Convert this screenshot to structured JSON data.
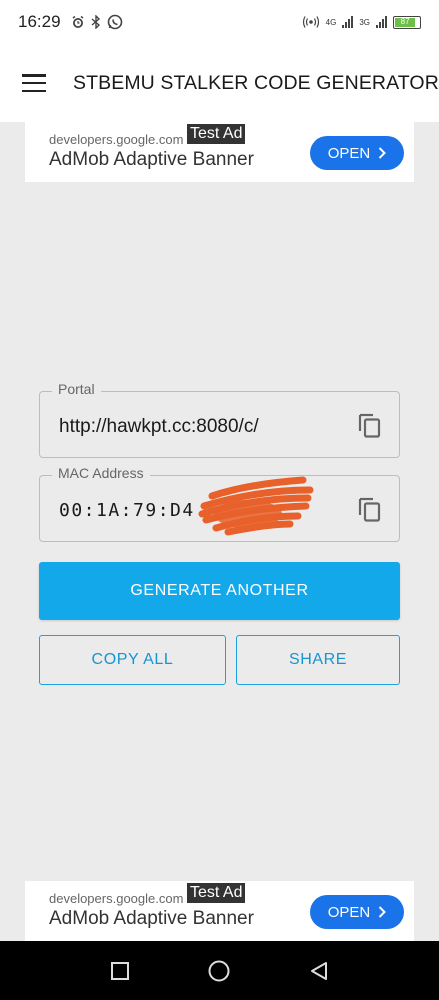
{
  "status_bar": {
    "time": "16:29",
    "network_4g": "4G",
    "network_3g": "3G",
    "battery": "87"
  },
  "app_bar": {
    "title": "STBEMU STALKER CODE GENERATOR"
  },
  "ads": {
    "top": {
      "domain": "developers.google.com",
      "tag": "Test Ad",
      "title": "AdMob Adaptive Banner",
      "button": "OPEN"
    },
    "bottom": {
      "domain": "developers.google.com",
      "tag": "Test Ad",
      "title": "AdMob Adaptive Banner",
      "button": "OPEN"
    }
  },
  "form": {
    "portal": {
      "label": "Portal",
      "value": "http://hawkpt.cc:8080/c/"
    },
    "mac": {
      "label": "MAC Address",
      "value": "00:1A:79:D4"
    }
  },
  "buttons": {
    "generate": "GENERATE ANOTHER",
    "copy_all": "COPY ALL",
    "share": "SHARE"
  },
  "icons": {
    "menu": "menu-icon",
    "copy": "copy-icon",
    "chevron": "chevron-right-icon",
    "nav_recents": "square-icon",
    "nav_home": "circle-icon",
    "nav_back": "triangle-back-icon"
  },
  "colors": {
    "primary": "#12a8ea",
    "ad_button": "#1a73e8",
    "redaction": "#e8602a",
    "background": "#ebebeb"
  }
}
